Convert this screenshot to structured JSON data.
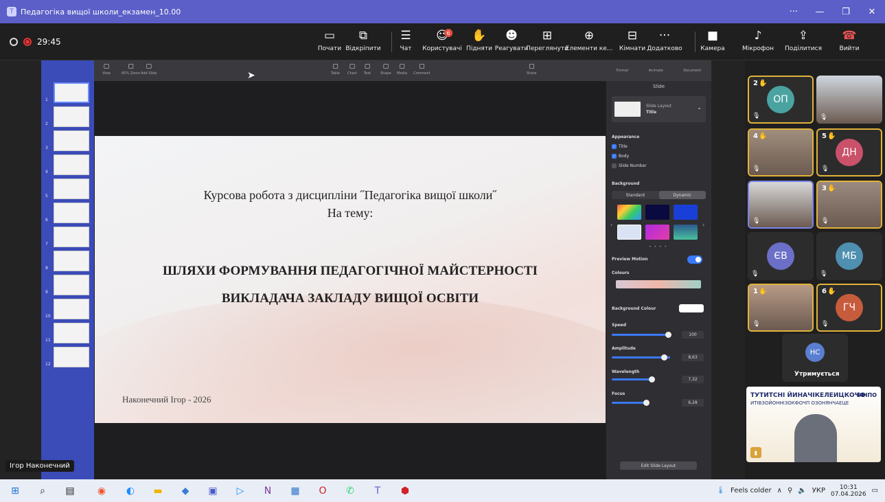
{
  "window": {
    "title": "Педагогіка вищої школи_екзамен_10.00",
    "icon": "teams-icon"
  },
  "meeting": {
    "timer": "29:45",
    "toolbar": [
      {
        "label": "Почати",
        "icon": "screen-share-start-icon"
      },
      {
        "label": "Відкріпити",
        "icon": "unpin-icon"
      },
      {
        "label": "Чат",
        "icon": "chat-icon"
      },
      {
        "label": "Користувачі",
        "icon": "people-icon",
        "badge": "6"
      },
      {
        "label": "Підняти",
        "icon": "raise-hand-icon"
      },
      {
        "label": "Реагувати",
        "icon": "react-icon"
      },
      {
        "label": "Переглянути",
        "icon": "view-icon"
      },
      {
        "label": "Елементи ке...",
        "icon": "apps-icon"
      },
      {
        "label": "Кімнати",
        "icon": "rooms-icon"
      },
      {
        "label": "Додатково",
        "icon": "more-icon"
      },
      {
        "label": "Камера",
        "icon": "camera-icon"
      },
      {
        "label": "Мікрофон",
        "icon": "microphone-icon"
      },
      {
        "label": "Поділитися",
        "icon": "share-icon"
      },
      {
        "label": "Вийти",
        "icon": "leave-icon"
      }
    ]
  },
  "keynote": {
    "top_left": [
      {
        "label": "View"
      },
      {
        "label": "60%  Zoom"
      },
      {
        "label": "Add Slide"
      }
    ],
    "top_mid": [
      {
        "label": "Table"
      },
      {
        "label": "Chart"
      },
      {
        "label": "Text"
      },
      {
        "label": "Shape"
      },
      {
        "label": "Media"
      },
      {
        "label": "Comment"
      }
    ],
    "share": "Share",
    "right_tabs": [
      {
        "label": "Format"
      },
      {
        "label": "Animate"
      },
      {
        "label": "Document"
      }
    ],
    "slide_numbers": [
      "1",
      "2",
      "3",
      "4",
      "5",
      "6",
      "7",
      "8",
      "9",
      "10",
      "11",
      "12"
    ],
    "slide": {
      "line1": "Курсова робота з дисципліни ˝Педагогіка вищої школи˝",
      "line2": "На тему:",
      "line3": "ШЛЯХИ ФОРМУВАННЯ ПЕДАГОГІЧНОЇ МАЙСТЕРНОСТІ",
      "line4": "ВИКЛАДАЧА ЗАКЛАДУ ВИЩОЇ ОСВІТИ",
      "author": "Наконечний Ігор - 2026"
    },
    "inspector": {
      "title": "Slide",
      "layout_label": "Slide Layout",
      "layout_value": "Title",
      "appearance": "Appearance",
      "check_title": "Title",
      "check_body": "Body",
      "check_slide_number": "Slide Number",
      "background": "Background",
      "seg_standard": "Standard",
      "seg_dynamic": "Dynamic",
      "preview_motion": "Preview Motion",
      "colours": "Colours",
      "background_colour": "Background Colour",
      "speed": "Speed",
      "speed_value": "100",
      "amplitude": "Amplitude",
      "amplitude_value": "8,63",
      "wavelength": "Wavelength",
      "wavelength_value": "7,32",
      "focus": "Focus",
      "focus_value": "6,28",
      "edit_button": "Edit Slide Layout"
    }
  },
  "presenter_name": "Ігор Наконечний",
  "participants": [
    {
      "initials": "ОП",
      "hand": "2",
      "color": "#4aa3a1"
    },
    {
      "initials": "",
      "hand": "",
      "color": "#cfd6de"
    },
    {
      "initials": "",
      "hand": "4",
      "color": "#a08e7c"
    },
    {
      "initials": "ДН",
      "hand": "5",
      "color": "#c9516a"
    },
    {
      "initials": "",
      "hand": "",
      "color": "#d8d8d8"
    },
    {
      "initials": "",
      "hand": "3",
      "color": "#9b8a80"
    },
    {
      "initials": "ЄВ",
      "hand": "",
      "color": "#6b6fc7"
    },
    {
      "initials": "МБ",
      "hand": "",
      "color": "#4f8fb0"
    },
    {
      "initials": "",
      "hand": "1",
      "color": "#b79a86"
    },
    {
      "initials": "ГЧ",
      "hand": "6",
      "color": "#c75c3c"
    },
    {
      "initials": "НС",
      "hand": "",
      "color": "#5a7fd0"
    }
  ],
  "overflow_label": "Утримується",
  "banner": {
    "line1": "ТУТИТСНІ ЙИНАЧІКЕЛЕИЦКОЧФ",
    "line2": "ИТІВЗОЙОННІЗОКФОЧП ОЗОНЯНЧАЕЦЕ",
    "logo": "БІНПО"
  },
  "taskbar": {
    "weather": "Feels colder",
    "lang": "УКР",
    "time": "10:31",
    "date": "07.04.2026"
  }
}
